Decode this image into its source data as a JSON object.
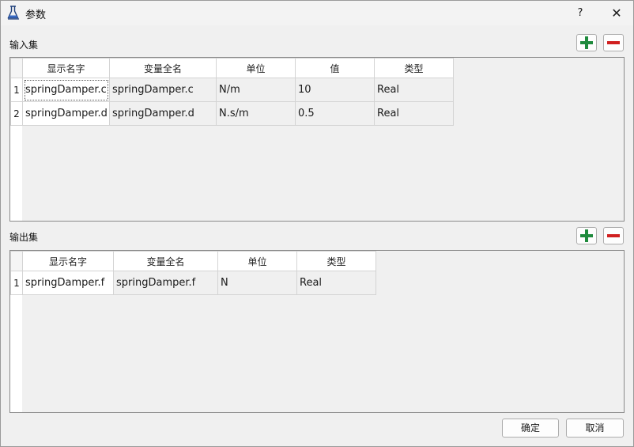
{
  "window": {
    "title": "参数",
    "help_label": "?",
    "close_label": "✕"
  },
  "input_set": {
    "label": "输入集",
    "columns": [
      "显示名字",
      "变量全名",
      "单位",
      "值",
      "类型"
    ],
    "rows": [
      {
        "num": "1",
        "display_name": "springDamper.c",
        "full_name": "springDamper.c",
        "unit": "N/m",
        "value": "10",
        "type": "Real"
      },
      {
        "num": "2",
        "display_name": "springDamper.d",
        "full_name": "springDamper.d",
        "unit": "N.s/m",
        "value": "0.5",
        "type": "Real"
      }
    ]
  },
  "output_set": {
    "label": "输出集",
    "columns": [
      "显示名字",
      "变量全名",
      "单位",
      "类型"
    ],
    "rows": [
      {
        "num": "1",
        "display_name": "springDamper.f",
        "full_name": "springDamper.f",
        "unit": "N",
        "type": "Real"
      }
    ]
  },
  "buttons": {
    "ok": "确定",
    "cancel": "取消"
  },
  "icons": {
    "add": "plus-icon",
    "remove": "minus-icon",
    "app": "flask-icon"
  },
  "colors": {
    "add": "#1e8a3c",
    "remove": "#d01f1f"
  }
}
